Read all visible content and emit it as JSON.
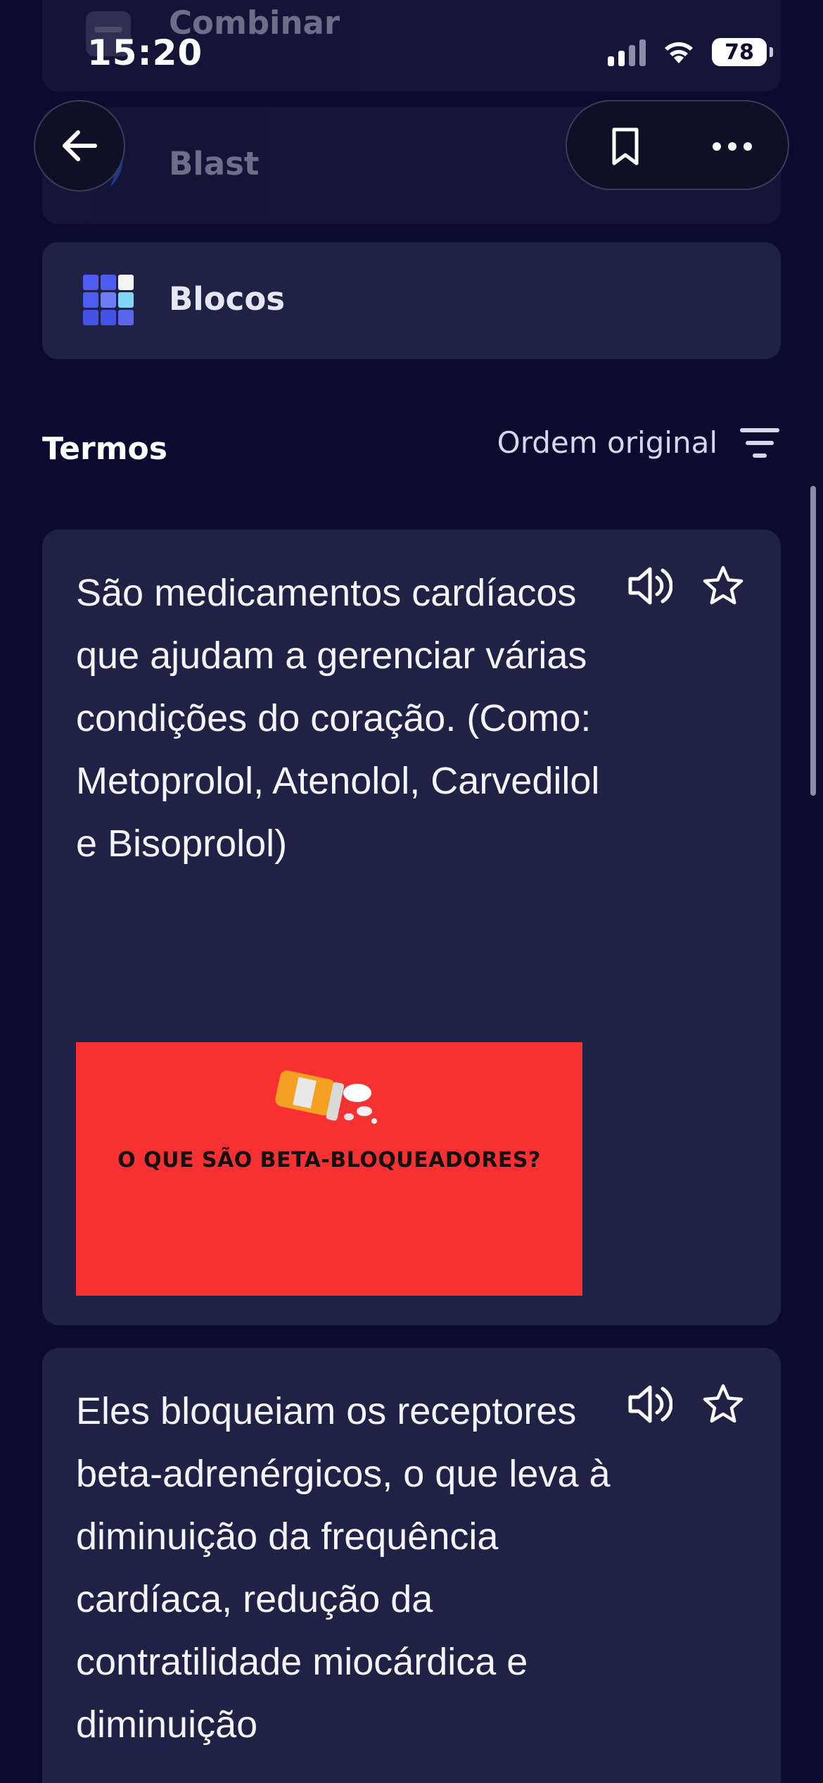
{
  "status_bar": {
    "time": "15:20",
    "battery": "78"
  },
  "study_modes": [
    {
      "label": "Combinar",
      "icon": "match-icon"
    },
    {
      "label": "Blast",
      "icon": "blast-icon"
    },
    {
      "label": "Blocos",
      "icon": "blocks-icon"
    }
  ],
  "nav": {
    "back": "arrow-left-icon",
    "bookmark": "bookmark-icon",
    "more": "more-horizontal-icon"
  },
  "terms_section": {
    "title": "Termos",
    "sort_label": "Ordem original"
  },
  "terms": [
    {
      "definition": "São medicamentos cardíacos que ajudam a gerenciar várias condições do coração. (Como: Metoprolol, Atenolol, Carvedilol e Bisoprolol)",
      "image_caption": "O QUE SÃO BETA-BLOQUEADORES?"
    },
    {
      "definition": "Eles bloqueiam os receptores beta-adrenérgicos, o que leva à diminuição da frequência cardíaca, redução da contratilidade miocárdica e diminuição"
    }
  ],
  "colors": {
    "background": "#0b0b30",
    "card": "#202245",
    "image_bg": "#f73131"
  }
}
